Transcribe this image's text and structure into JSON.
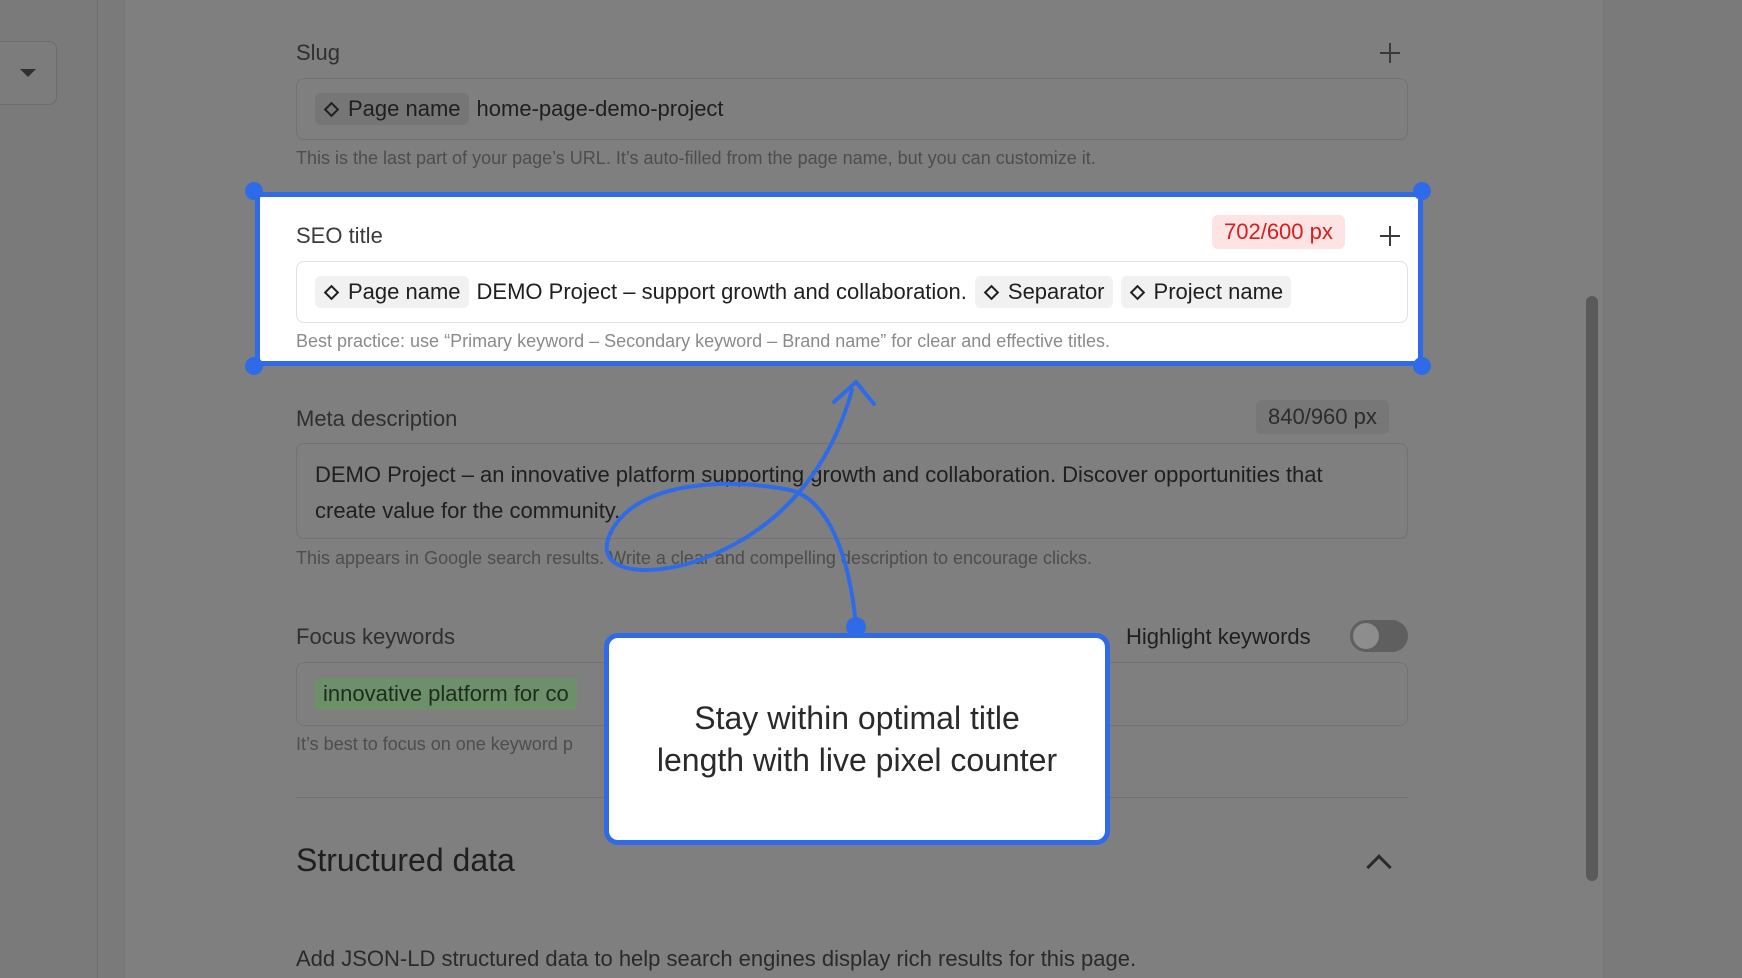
{
  "slug": {
    "label": "Slug",
    "chip": "Page name",
    "value": "home-page-demo-project",
    "help": "This is the last part of your page’s URL. It’s auto-filled from the page name, but you can customize it."
  },
  "seo_title": {
    "label": "SEO title",
    "counter": "702/600 px",
    "chips": [
      "Page name",
      "Separator",
      "Project name"
    ],
    "text": "DEMO Project – support growth and collaboration.",
    "help": "Best practice: use “Primary keyword – Secondary keyword – Brand name” for clear and effective titles."
  },
  "meta": {
    "label": "Meta description",
    "counter": "840/960 px",
    "value": "DEMO Project – an innovative platform supporting growth and collaboration. Discover opportunities that create value for the community.",
    "help": "This appears in Google search results. Write a clear and compelling description to encourage clicks."
  },
  "focus": {
    "label": "Focus keywords",
    "highlight_label": "Highlight keywords",
    "highlight_on": false,
    "keyword": "innovative platform for co",
    "help": "It’s best to focus on one keyword p"
  },
  "structured": {
    "title": "Structured data",
    "desc": "Add JSON-LD structured data to help search engines display rich results for this page."
  },
  "callout": {
    "text": "Stay within optimal title length with live pixel counter"
  },
  "colors": {
    "accent": "#2f6be8",
    "error_bg": "#fde3e3",
    "error_text": "#d32020"
  }
}
